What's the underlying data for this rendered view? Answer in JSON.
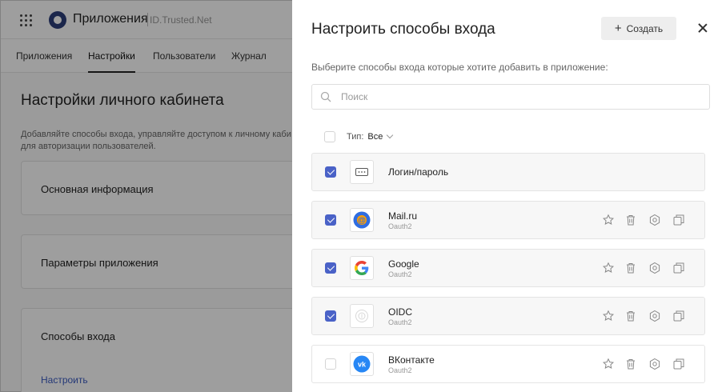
{
  "app": {
    "title": "Приложения",
    "subtitle": "ID.Trusted.Net",
    "tabs": [
      "Приложения",
      "Настройки",
      "Пользователи",
      "Журнал"
    ],
    "active_tab": "Настройки"
  },
  "page": {
    "title": "Настройки личного кабинета",
    "description": "Добавляйте способы входа, управляйте доступом к личному каби\nдля авторизации пользователей.",
    "cards": [
      {
        "title": "Основная информация"
      },
      {
        "title": "Параметры приложения"
      },
      {
        "title": "Способы входа",
        "link": "Настроить"
      }
    ]
  },
  "drawer": {
    "title": "Настроить способы входа",
    "create_label": "Создать",
    "description": "Выберите способы входа которые хотите добавить в приложение:",
    "search": {
      "placeholder": "Поиск",
      "value": ""
    },
    "filter": {
      "label": "Тип:",
      "value": "Все",
      "select_all_checked": false
    },
    "items": [
      {
        "name": "Логин/пароль",
        "type": "",
        "checked": true,
        "icon": "password-icon",
        "has_actions": false
      },
      {
        "name": "Mail.ru",
        "type": "Oauth2",
        "checked": true,
        "icon": "mailru-icon",
        "has_actions": true
      },
      {
        "name": "Google",
        "type": "Oauth2",
        "checked": true,
        "icon": "google-icon",
        "has_actions": true
      },
      {
        "name": "OIDC",
        "type": "Oauth2",
        "checked": true,
        "icon": "oidc-icon",
        "has_actions": true
      },
      {
        "name": "ВКонтакте",
        "type": "Oauth2",
        "checked": false,
        "icon": "vk-icon",
        "has_actions": true
      }
    ]
  },
  "colors": {
    "accent": "#4a62c7",
    "mailru": "#2f6de1",
    "vk": "#2787f5",
    "overlay": "rgba(0,0,0,0.38)"
  }
}
